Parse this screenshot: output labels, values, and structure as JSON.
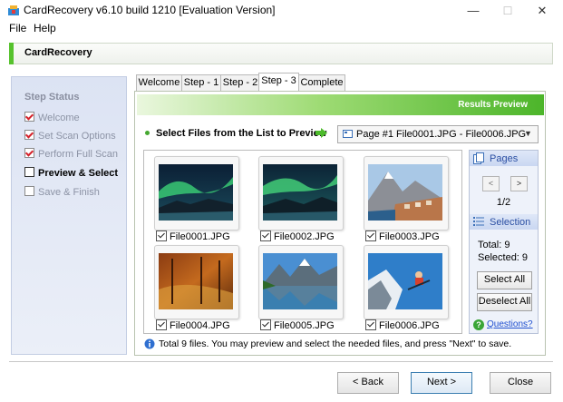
{
  "window": {
    "title": "CardRecovery v6.10 build 1210 [Evaluation Version]",
    "minimize_glyph": "—",
    "maximize_glyph": "☐",
    "close_glyph": "✕"
  },
  "menu": {
    "file": "File",
    "help": "Help"
  },
  "header": {
    "title": "CardRecovery",
    "accent_color": "#56c22d"
  },
  "sidebar": {
    "title": "Step Status",
    "steps": [
      {
        "label": "Welcome",
        "state": "done"
      },
      {
        "label": "Set Scan Options",
        "state": "done"
      },
      {
        "label": "Perform Full Scan",
        "state": "done"
      },
      {
        "label": "Preview & Select",
        "state": "current"
      },
      {
        "label": "Save & Finish",
        "state": "pending"
      }
    ]
  },
  "tabs": [
    {
      "label": "Welcome"
    },
    {
      "label": "Step - 1"
    },
    {
      "label": "Step - 2"
    },
    {
      "label": "Step - 3",
      "active": true
    },
    {
      "label": "Complete"
    }
  ],
  "main": {
    "banner": "Results Preview",
    "select_label": "Select Files from the List to Preview",
    "page_select": "Page #1   File0001.JPG - File0006.JPG",
    "files": [
      {
        "name": "File0001.JPG",
        "checked": true,
        "image": "aurora-icon"
      },
      {
        "name": "File0002.JPG",
        "checked": true,
        "image": "aurora-icon"
      },
      {
        "name": "File0003.JPG",
        "checked": true,
        "image": "mountain-village-icon"
      },
      {
        "name": "File0004.JPG",
        "checked": true,
        "image": "autumn-forest-icon"
      },
      {
        "name": "File0005.JPG",
        "checked": true,
        "image": "mountain-lake-icon"
      },
      {
        "name": "File0006.JPG",
        "checked": true,
        "image": "skier-icon"
      }
    ],
    "info": "Total 9 files.  You may preview and select the needed files, and press \"Next\" to save."
  },
  "right_panel": {
    "pages_title": "Pages",
    "prev": "<",
    "next": ">",
    "page_counter": "1/2",
    "selection_title": "Selection",
    "total": "Total: 9",
    "selected": "Selected: 9",
    "select_all": "Select All",
    "deselect_all": "Deselect All",
    "questions": "Questions?"
  },
  "buttons": {
    "back": "< Back",
    "next": "Next >",
    "close": "Close"
  }
}
